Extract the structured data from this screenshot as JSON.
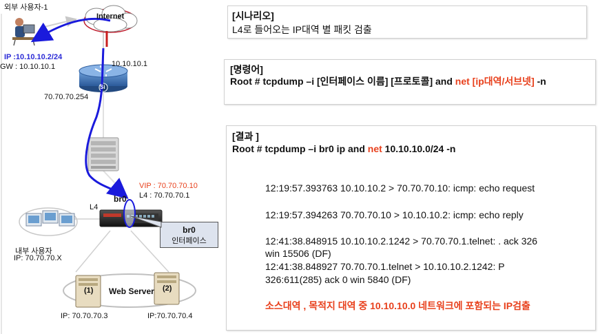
{
  "diagram": {
    "external_user_label": "외부 사용자-1",
    "internet_label": "Internet",
    "ip_label": "IP :10.10.10.2/24",
    "gw_label": "GW : 10.10.10.1",
    "router_label": "Si",
    "router_ip_top": "10.10.10.1",
    "router_ip_bottom": "70.70.70.254",
    "vip_label": "VIP  : 70.70.70.10",
    "l4_ip_label": "L4   : 70.70.70.1",
    "l4_label": "L4",
    "br0_label": "br0",
    "callout_title": "br0",
    "callout_sub": "인터페이스",
    "internal_user_label": "내부 사용자",
    "internal_user_ip": "IP: 70.70.70.X",
    "web_server_label": "Web Server",
    "server1_tag": "(1)",
    "server2_tag": "(2)",
    "server1_ip": "IP: 70.70.70.3",
    "server2_ip": "IP:70.70.70.4"
  },
  "scenario": {
    "heading": "[시나리오]",
    "text": "L4로 들어오는 IP대역 별 패킷 검출"
  },
  "command": {
    "heading": "[명령어]",
    "line_prefix": "Root # tcpdump –i [인터페이스 이름] [프로토콜] and ",
    "line_red": "net [ip대역/서브넷]",
    "line_suffix": " -n"
  },
  "result": {
    "heading": "[결과 ]",
    "cmd_prefix": "Root # tcpdump –i br0 ip and ",
    "cmd_red": "net",
    "cmd_suffix": " 10.10.10.0/24 -n",
    "lines": [
      "12:19:57.393763  10.10.10.2 > 70.70.70.10:  icmp: echo request",
      "12:19:57.394263  70.70.70.10 > 10.10.10.2:  icmp: echo reply",
      "12:41:38.848915 10.10.10.2.1242 > 70.70.70.1.telnet: . ack 326",
      "win 15506 (DF)",
      "12:41:38.848927 70.70.70.1.telnet > 10.10.10.2.1242: P",
      "326:611(285) ack 0 win 5840 (DF)"
    ],
    "note": "소스대역 , 목적지 대역 중 10.10.10.0 네트워크에 포함되는 IP검출"
  },
  "colors": {
    "accent_red": "#e8401c",
    "flow_blue": "#1a1adc",
    "ip_blue": "#2b2bd6",
    "router_blue": "#3a6fb8"
  }
}
